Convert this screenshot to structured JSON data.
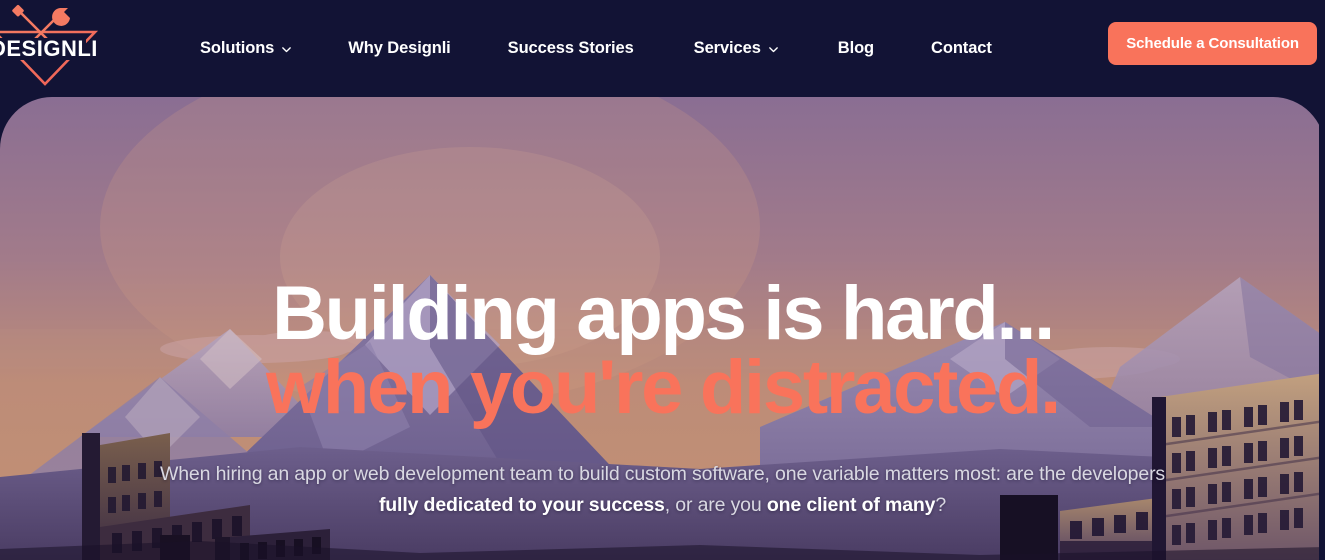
{
  "brand": {
    "name": "DESIGNLI",
    "logo_icon": "wrench-screwdriver-triangle-logo",
    "accent_color": "#f9735b",
    "navbar_bg": "#121335"
  },
  "navbar": {
    "items": [
      {
        "label": "Solutions",
        "has_dropdown": true,
        "icon": "chevron-down-icon"
      },
      {
        "label": "Why Designli",
        "has_dropdown": false
      },
      {
        "label": "Success Stories",
        "has_dropdown": false
      },
      {
        "label": "Services",
        "has_dropdown": true,
        "icon": "chevron-down-icon"
      },
      {
        "label": "Blog",
        "has_dropdown": false
      },
      {
        "label": "Contact",
        "has_dropdown": false
      }
    ],
    "cta": {
      "label": "Schedule a Consultation",
      "bg_color": "#f9735b",
      "text_color": "#ffffff"
    }
  },
  "hero": {
    "headline_line1": "Building apps is hard...",
    "headline_line2": "when you're distracted.",
    "headline_line1_color": "#ffffff",
    "headline_line2_color": "#f9735b",
    "subcopy": {
      "part1": "When hiring an app or web development team to build custom software, one variable matters most: are the developers ",
      "strong1": "fully dedicated to your success",
      "part2": ", or are you ",
      "strong2": "one client of many",
      "part3": "?"
    },
    "background_art": "sunset-low-poly-mountains-and-city-buildings",
    "sky_top_color": "#8d6f91",
    "sky_bottom_color": "#c08b74",
    "mountain_color": "#8a7ba3",
    "building_dark_color": "#2b2040",
    "building_light_color": "#b59176"
  }
}
